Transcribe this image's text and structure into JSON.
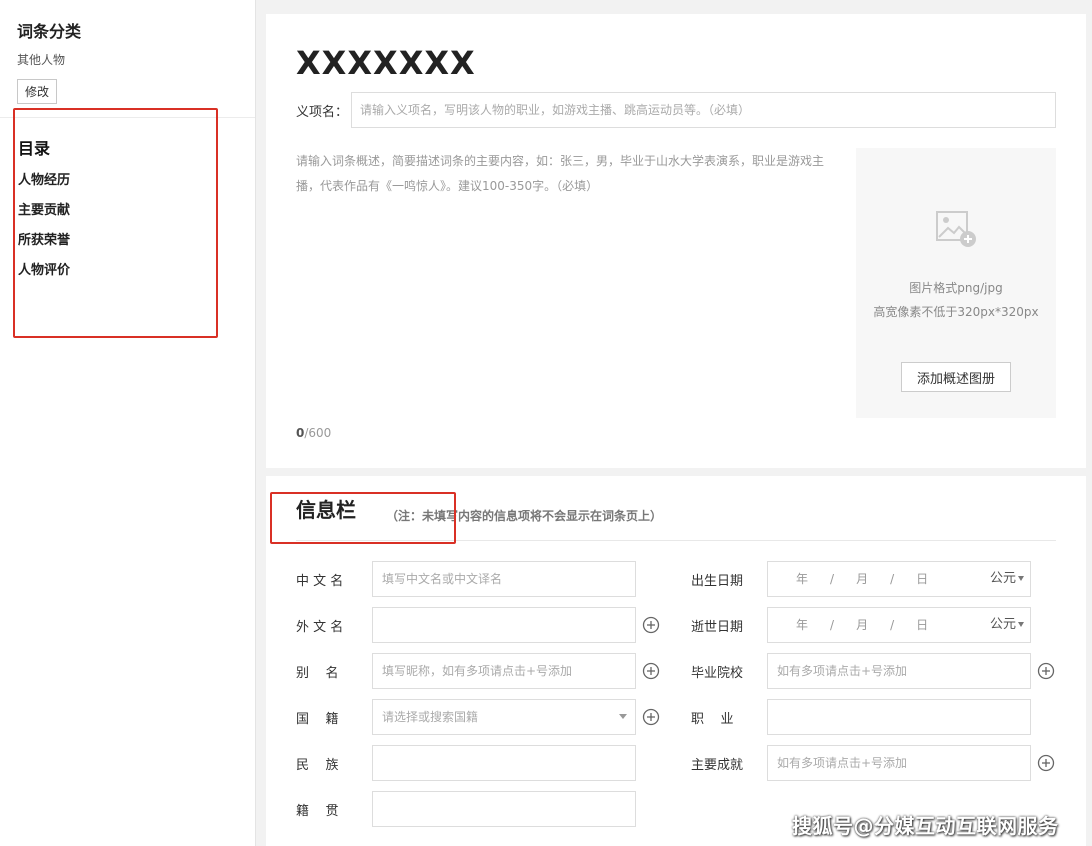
{
  "sidebar": {
    "category_title": "词条分类",
    "category_value": "其他人物",
    "edit_button": "修改",
    "toc_title": "目录",
    "toc_items": [
      "人物经历",
      "主要贡献",
      "所获荣誉",
      "人物评价"
    ]
  },
  "entry": {
    "title": "XXXXXXX",
    "yi_label": "义项名：",
    "yi_placeholder": "请输入义项名，写明该人物的职业，如游戏主播、跳高运动员等。（必填）",
    "summary_placeholder": "请输入词条概述，简要描述词条的主要内容，如：张三，男，毕业于山水大学表演系，职业是游戏主播，代表作品有《一鸣惊人》。建议100-350字。（必填）",
    "counter_current": "0",
    "counter_max": "/600"
  },
  "image_upload": {
    "icon": "image-add-icon",
    "line1": "图片格式png/jpg",
    "line2": "高宽像素不低于320px*320px",
    "button": "添加概述图册"
  },
  "info": {
    "title": "信息栏",
    "note": "（注：未填写内容的信息项将不会显示在词条页上）",
    "fields": {
      "chinese_name": {
        "label": "中 文 名",
        "placeholder": "填写中文名或中文译名"
      },
      "foreign_name": {
        "label": "外 文 名",
        "placeholder": ""
      },
      "alias": {
        "label": "别    名",
        "placeholder": "填写昵称，如有多项请点击+号添加"
      },
      "nationality": {
        "label": "国    籍",
        "placeholder": "请选择或搜索国籍"
      },
      "ethnicity": {
        "label": "民    族",
        "placeholder": ""
      },
      "hometown": {
        "label": "籍    贯",
        "placeholder": ""
      },
      "birth_date": {
        "label": "出生日期",
        "year": "年",
        "month": "月",
        "day": "日",
        "sep": "/",
        "era": "公元"
      },
      "death_date": {
        "label": "逝世日期",
        "year": "年",
        "month": "月",
        "day": "日",
        "sep": "/",
        "era": "公元"
      },
      "school": {
        "label": "毕业院校",
        "placeholder": "如有多项请点击+号添加"
      },
      "occupation": {
        "label": "职    业",
        "placeholder": ""
      },
      "achievements": {
        "label": "主要成就",
        "placeholder": "如有多项请点击+号添加"
      }
    }
  },
  "watermark": "搜狐号@分媒互动互联网服务",
  "colors": {
    "highlight_red": "#d93025",
    "background": "#f2f2f2"
  }
}
